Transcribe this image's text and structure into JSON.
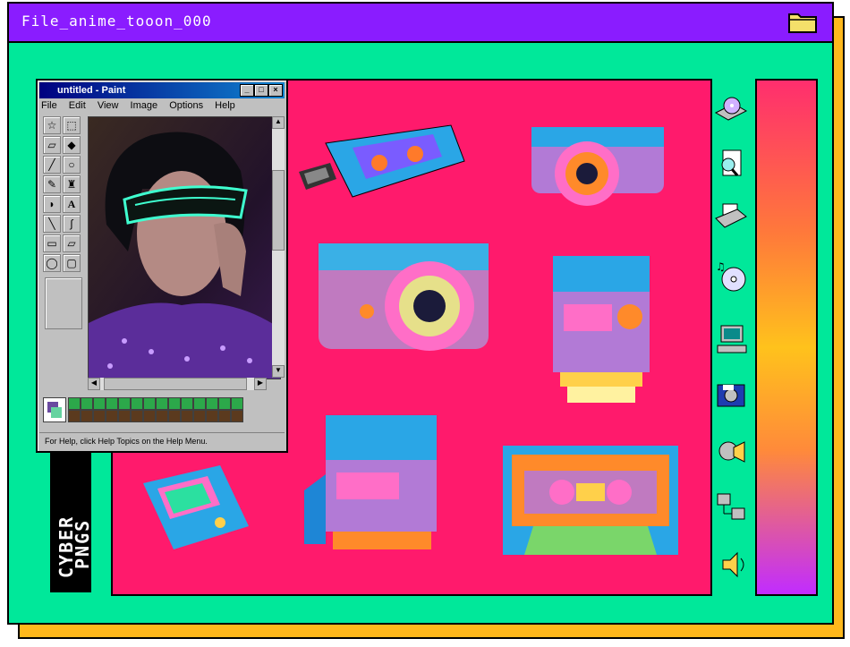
{
  "window": {
    "title": "File_anime_tooon_000",
    "colors": {
      "frame": "#00e89a",
      "titlebar": "#8a1cff",
      "shadow": "#ffb81c",
      "stage": "#ff1a6c"
    }
  },
  "cyber_label": {
    "line1": "CYBER",
    "line2": "PNGS"
  },
  "paint": {
    "title": "untitled - Paint",
    "menu": [
      "File",
      "Edit",
      "View",
      "Image",
      "Options",
      "Help"
    ],
    "status": "For Help, click Help Topics on the Help Menu.",
    "controls": [
      "_",
      "□",
      "×"
    ],
    "tools": [
      "select-star",
      "select-rect",
      "eraser",
      "fill",
      "picker",
      "magnifier",
      "pencil",
      "brush",
      "airbrush",
      "A",
      "line",
      "curve",
      "rect",
      "polygon",
      "ellipse",
      "rounded-rect"
    ]
  },
  "stage_items": [
    "usb-cassette",
    "camera-small",
    "camera-large",
    "polaroid-1",
    "gameboy",
    "polaroid-2",
    "cassette-tape"
  ],
  "side_icons": [
    "cd-drive-icon",
    "document-search-icon",
    "printer-icon",
    "music-cd-icon",
    "computer-icon",
    "camera-floppy-icon",
    "sound-search-icon",
    "network-icon",
    "speaker-icon"
  ]
}
